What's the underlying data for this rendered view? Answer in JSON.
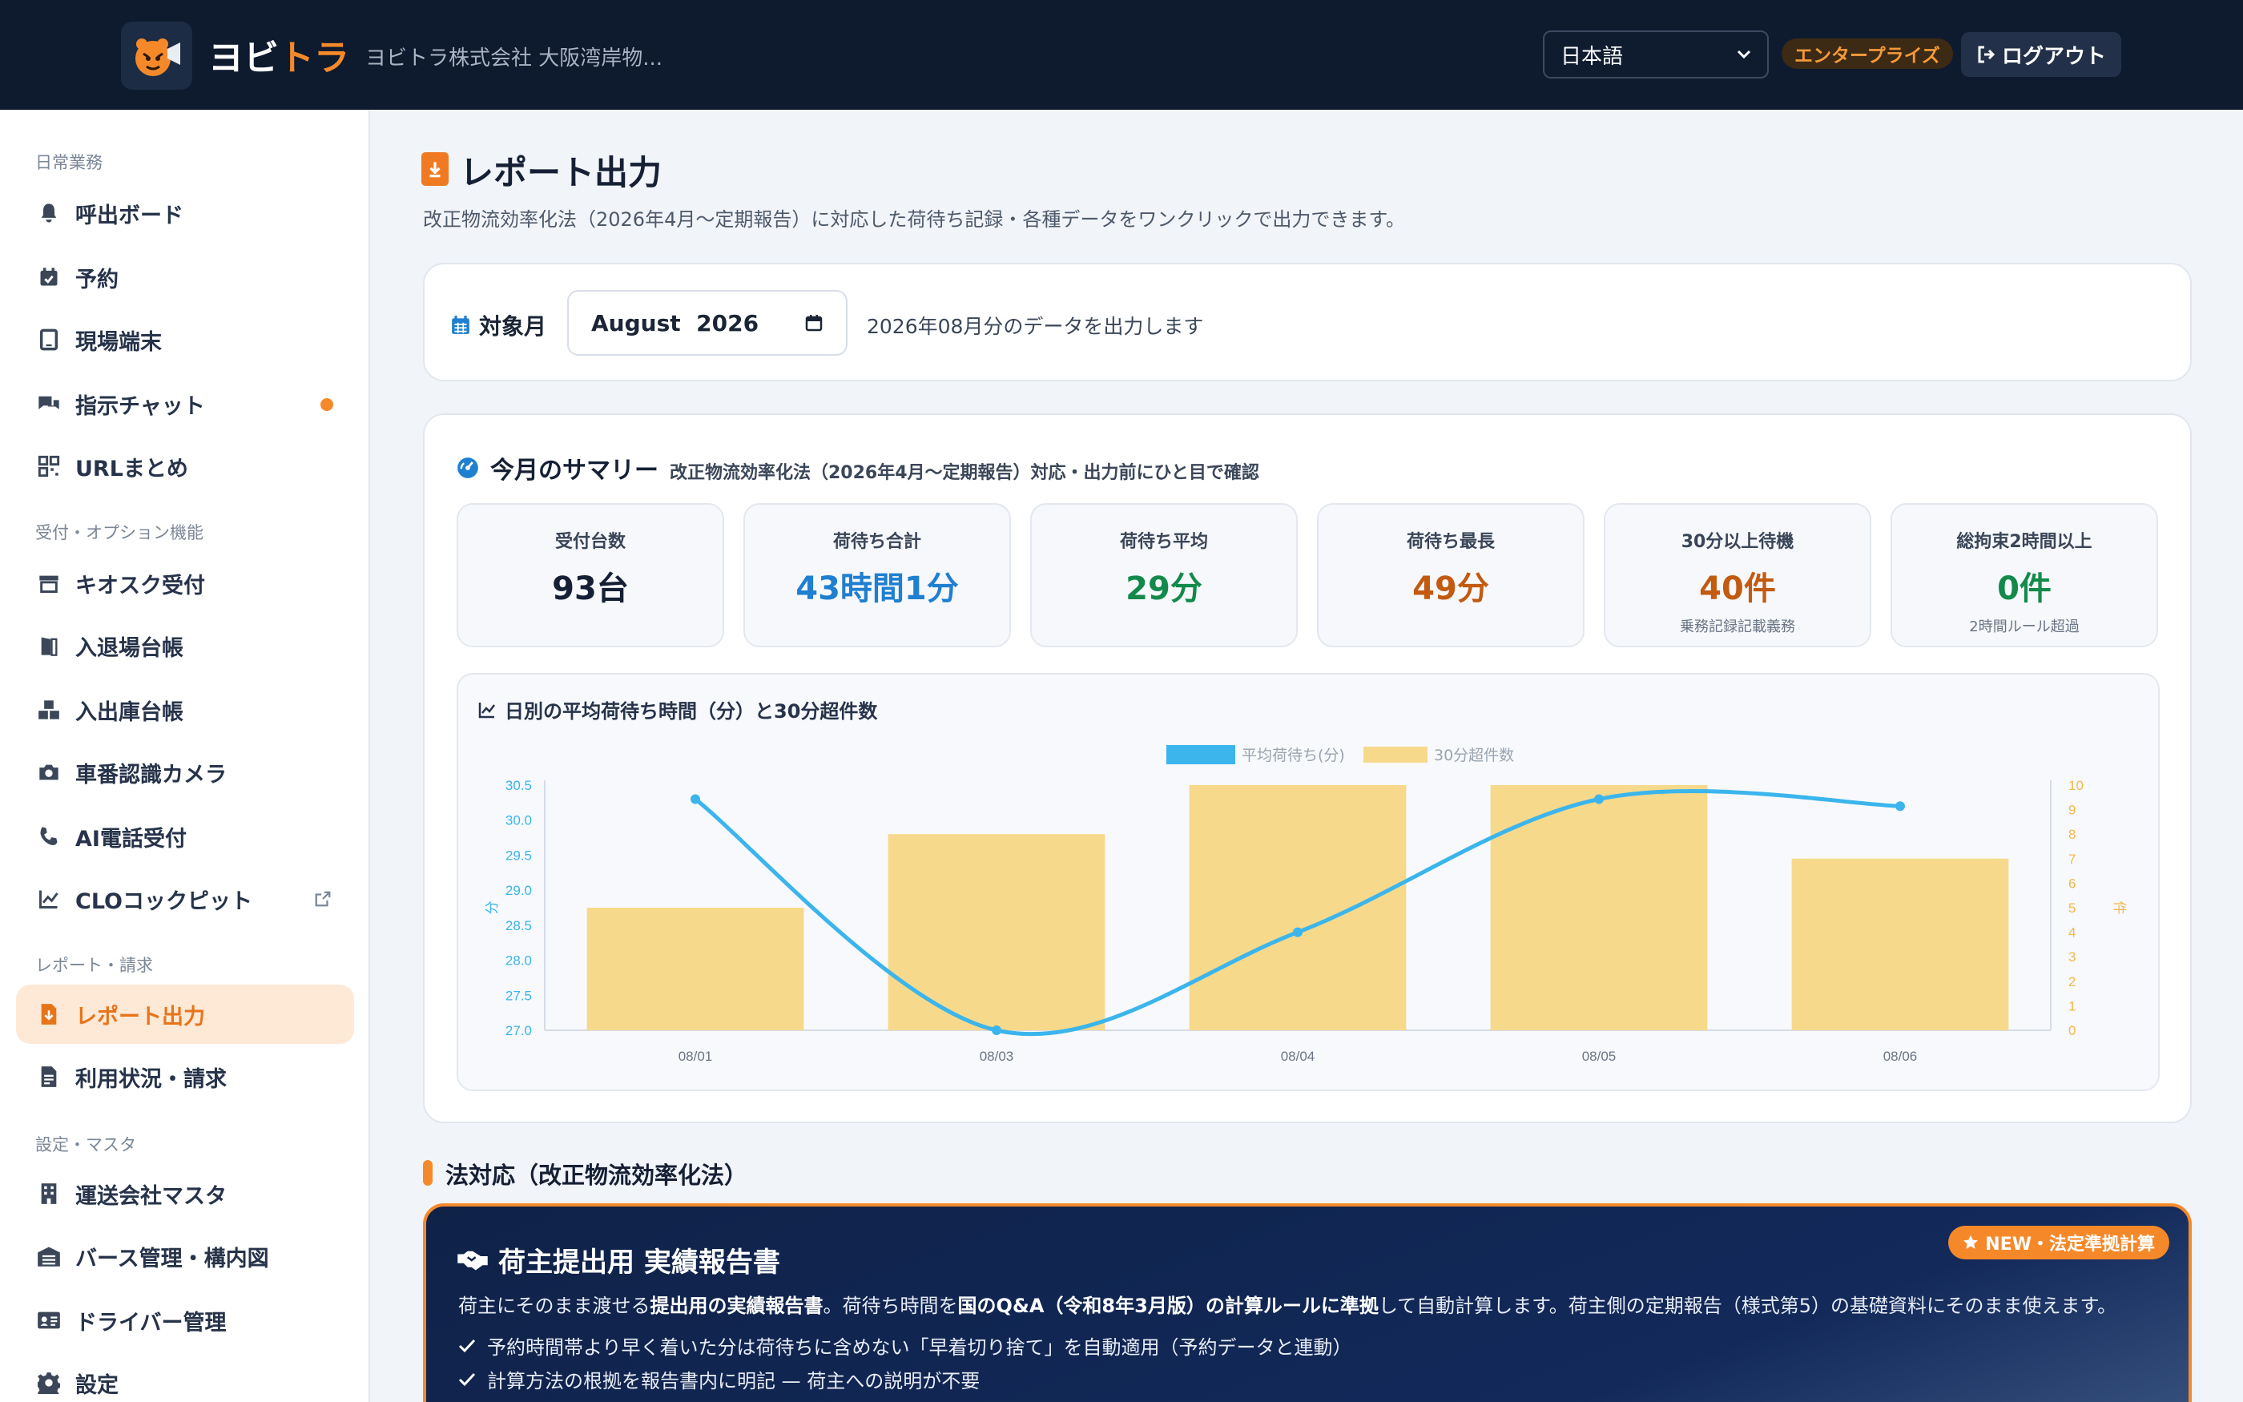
{
  "header": {
    "brand_prefix": "ヨビ",
    "brand_suffix": "トラ",
    "company": "ヨビトラ株式会社 大阪湾岸物...",
    "language": "日本語",
    "plan": "エンタープライズ",
    "logout": "ログアウト"
  },
  "sidebar": {
    "sections": [
      {
        "label": "日常業務",
        "items": [
          {
            "label": "呼出ボード",
            "icon": "bell-icon"
          },
          {
            "label": "予約",
            "icon": "calendar-check-icon"
          },
          {
            "label": "現場端末",
            "icon": "tablet-icon"
          },
          {
            "label": "指示チャット",
            "icon": "chat-icon"
          },
          {
            "label": "URLまとめ",
            "icon": "qr-icon"
          }
        ]
      },
      {
        "label": "受付・オプション機能",
        "items": [
          {
            "label": "キオスク受付",
            "icon": "kiosk-icon"
          },
          {
            "label": "入退場台帳",
            "icon": "door-icon"
          },
          {
            "label": "入出庫台帳",
            "icon": "boxes-icon"
          },
          {
            "label": "車番認識カメラ",
            "icon": "camera-icon"
          },
          {
            "label": "AI電話受付",
            "icon": "phone-icon"
          },
          {
            "label": "CLOコックピット",
            "icon": "chart-line-icon"
          }
        ]
      },
      {
        "label": "レポート・請求",
        "items": [
          {
            "label": "レポート出力",
            "icon": "file-export-icon"
          },
          {
            "label": "利用状況・請求",
            "icon": "invoice-icon"
          }
        ]
      },
      {
        "label": "設定・マスタ",
        "items": [
          {
            "label": "運送会社マスタ",
            "icon": "building-icon"
          },
          {
            "label": "バース管理・構内図",
            "icon": "warehouse-icon"
          },
          {
            "label": "ドライバー管理",
            "icon": "id-card-icon"
          },
          {
            "label": "設定",
            "icon": "gear-icon"
          }
        ]
      }
    ]
  },
  "page": {
    "title": "レポート出力",
    "description": "改正物流効率化法（2026年4月〜定期報告）に対応した荷待ち記録・各種データをワンクリックで出力できます。"
  },
  "month": {
    "label": "対象月",
    "value": "August  2026",
    "note": "2026年08月分のデータを出力します"
  },
  "summary": {
    "title": "今月のサマリー",
    "subtitle": "改正物流効率化法（2026年4月〜定期報告）対応・出力前にひと目で確認",
    "stats": [
      {
        "label": "受付台数",
        "value": "93台",
        "note": "",
        "color": "#152035"
      },
      {
        "label": "荷待ち合計",
        "value": "43時間1分",
        "note": "",
        "color": "#1f7fd0"
      },
      {
        "label": "荷待ち平均",
        "value": "29分",
        "note": "",
        "color": "#138a4b"
      },
      {
        "label": "荷待ち最長",
        "value": "49分",
        "note": "",
        "color": "#c25a10"
      },
      {
        "label": "30分以上待機",
        "value": "40件",
        "note": "乗務記録記載義務",
        "color": "#c25a10"
      },
      {
        "label": "総拘束2時間以上",
        "value": "0件",
        "note": "2時間ルール超過",
        "color": "#138a4b"
      }
    ],
    "chart_title": "日別の平均荷待ち時間（分）と30分超件数"
  },
  "chart_data": {
    "type": "bar",
    "categories": [
      "08/01",
      "08/03",
      "08/04",
      "08/05",
      "08/06"
    ],
    "series": [
      {
        "name": "平均荷待ち(分)",
        "type": "line",
        "axis": "left",
        "values": [
          30.3,
          27.0,
          28.4,
          30.3,
          30.2
        ],
        "color": "#3bb5ec"
      },
      {
        "name": "30分超件数",
        "type": "bar",
        "axis": "right",
        "values": [
          5,
          8,
          10,
          10,
          7
        ],
        "color": "#f7d98b"
      }
    ],
    "y_left": {
      "label": "分",
      "ticks": [
        "30.5",
        "30.0",
        "29.5",
        "29.0",
        "28.5",
        "28.0",
        "27.5",
        "27.0"
      ],
      "range": [
        27.0,
        30.5
      ]
    },
    "y_right": {
      "label": "件",
      "ticks": [
        "10",
        "9",
        "8",
        "7",
        "6",
        "5",
        "4",
        "3",
        "2",
        "1",
        "0"
      ],
      "range": [
        0,
        10
      ]
    },
    "legend": "top-center"
  },
  "legal": {
    "section_title": "法対応（改正物流効率化法）",
    "badge": "NEW・法定準拠計算",
    "card_title": "荷主提出用 実績報告書",
    "desc_1": "荷主にそのまま渡せる",
    "desc_2": "提出用の実績報告書",
    "desc_3": "。荷待ち時間を",
    "desc_4": "国のQ&A（令和8年3月版）の計算ルールに準拠",
    "desc_5": "して自動計算します。荷主側の定期報告（様式第5）の基礎資料にそのまま使えます。",
    "checks": [
      "予約時間帯より早く着いた分は荷待ちに含めない「早着切り捨て」を自動適用（予約データと連動）",
      "計算方法の根拠を報告書内に明記 — 荷主への説明が不要"
    ]
  }
}
